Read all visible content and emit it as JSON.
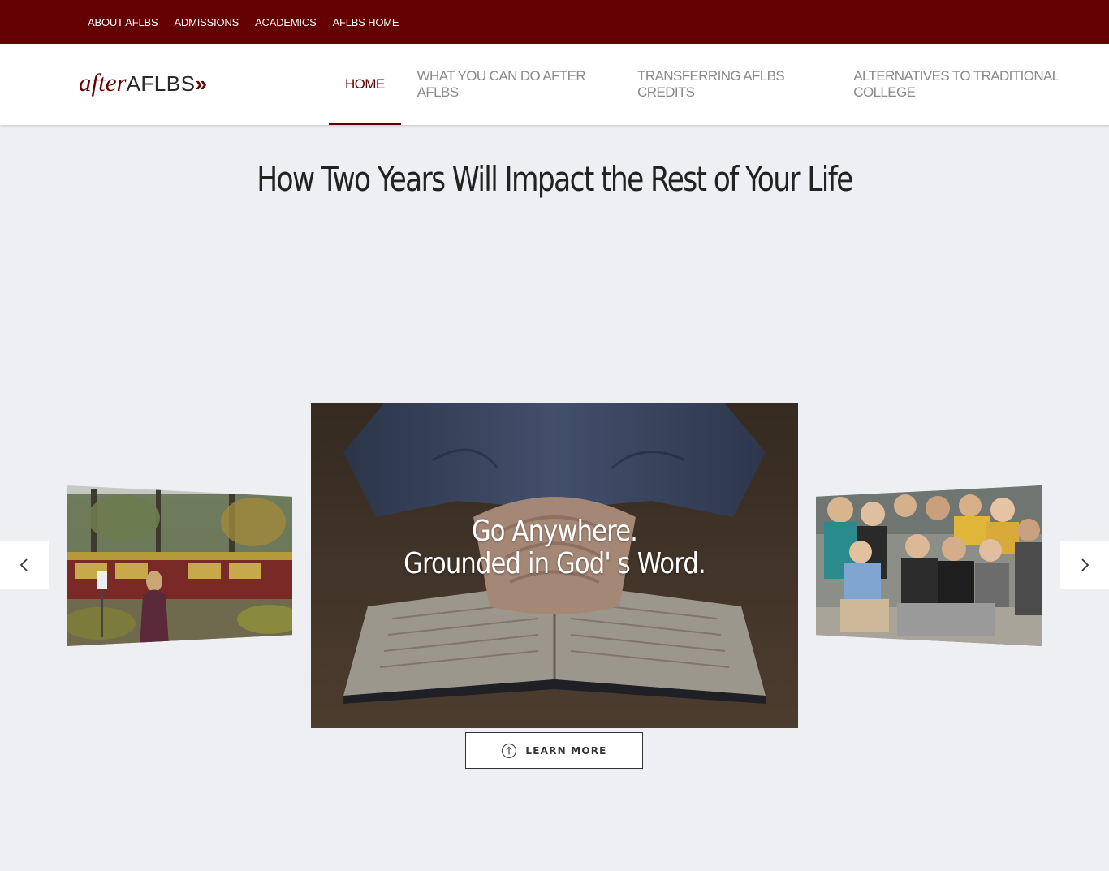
{
  "topbar": {
    "links": [
      "ABOUT AFLBS",
      "ADMISSIONS",
      "ACADEMICS",
      "AFLBS HOME"
    ]
  },
  "header": {
    "logo_after": "after",
    "logo_aflbs": "AFLBS",
    "logo_chevron": "»",
    "nav": [
      "HOME",
      "WHAT YOU CAN DO AFTER AFLBS",
      "TRANSFERRING AFLBS CREDITS",
      "ALTERNATIVES TO TRADITIONAL COLLEGE"
    ],
    "active_index": 0
  },
  "headline": "How Two Years Will Impact the Rest of Your Life",
  "carousel": {
    "caption_line1": "Go Anywhere.",
    "caption_line2": "Grounded in God' s Word.",
    "prev_icon": "chevron-left-icon",
    "next_icon": "chevron-right-icon"
  },
  "learn_more": {
    "label": "LEARN MORE",
    "icon": "arrow-up-circle-icon"
  },
  "colors": {
    "brand": "#650002",
    "background": "#edeff2"
  }
}
